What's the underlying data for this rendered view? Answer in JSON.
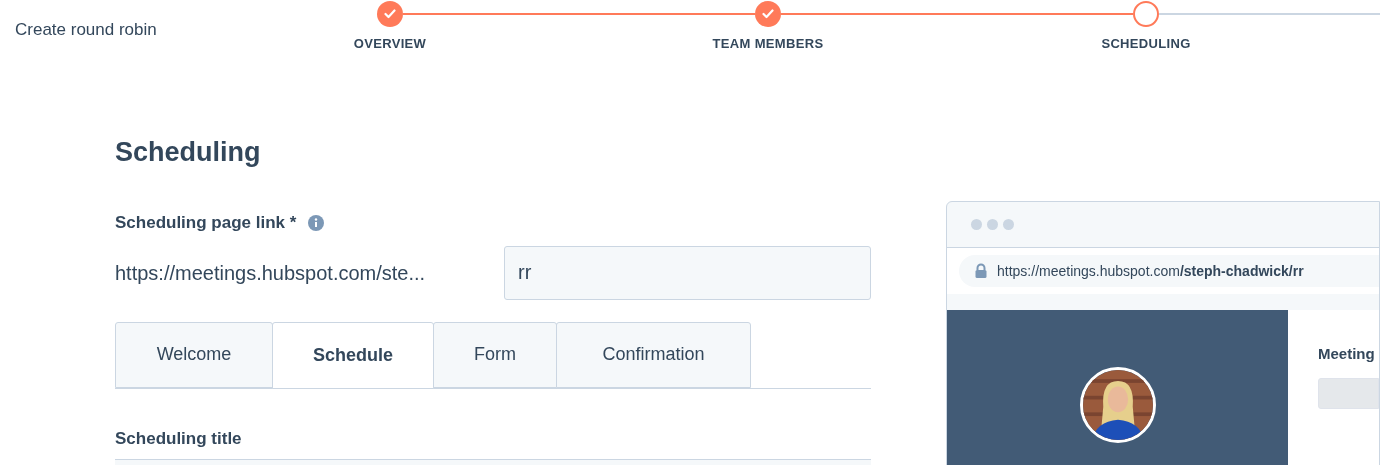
{
  "page_title": "Create round robin",
  "steps": [
    {
      "label": "OVERVIEW",
      "completed": true,
      "selected": false
    },
    {
      "label": "TEAM MEMBERS",
      "completed": true,
      "selected": false
    },
    {
      "label": "SCHEDULING",
      "completed": false,
      "selected": true
    }
  ],
  "section_title": "Scheduling",
  "link_field": {
    "label": "Scheduling page link *",
    "prefix": "https://meetings.hubspot.com/ste...",
    "value": "rr"
  },
  "tabs": [
    {
      "label": "Welcome",
      "selected": false
    },
    {
      "label": "Schedule",
      "selected": true
    },
    {
      "label": "Form",
      "selected": false
    },
    {
      "label": "Confirmation",
      "selected": false
    }
  ],
  "scheduling_title_label": "Scheduling title",
  "preview": {
    "url": "https://meetings.hubspot.com**/steph-chadwick/rr**",
    "side_label": "Meeting"
  }
}
